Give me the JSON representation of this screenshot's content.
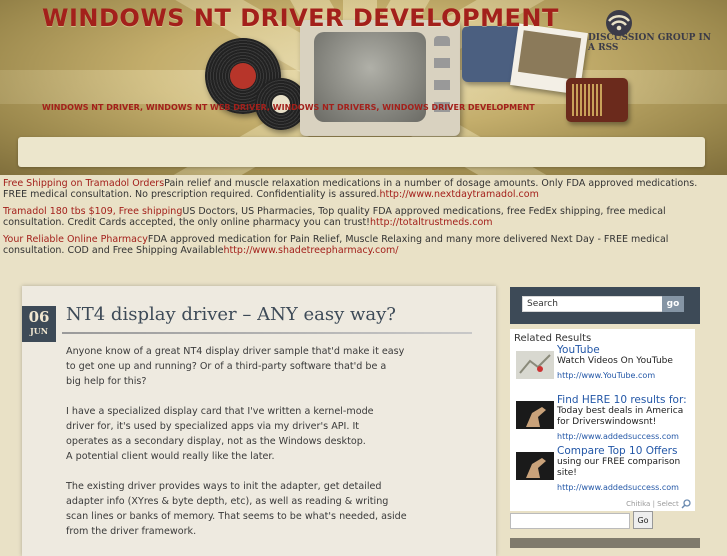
{
  "header": {
    "title": "WINDOWS NT DRIVER DEVELOPMENT",
    "description": "WINDOWS NT DRIVER, WINDOWS NT WEB DRIVER, WINDOWS NT DRIVERS, WINDOWS DRIVER DEVELOPMENT",
    "rss_label": "DISCUSSION GROUP IN A RSS"
  },
  "ads": [
    {
      "link": "Free Shipping on Tramadol Orders",
      "text": "Pain relief and muscle relaxation medications in a number of dosage amounts. Only FDA approved medications. FREE medical consultation. No prescription required. Confidentiality is assured.",
      "url": "http://www.nextdaytramadol.com"
    },
    {
      "link": "Tramadol 180 tbs $109, Free shipping",
      "text": "US Doctors, US Pharmacies, Top quality FDA approved medications, free FedEx shipping, free medical consultation. Credit Cards accepted, the only online pharmacy you can trust!",
      "url": "http://totaltrustmeds.com"
    },
    {
      "link": "Your Reliable Online Pharmacy",
      "text": "FDA approved medication for Pain Relief, Muscle Relaxing and many more delivered Next Day - FREE medical consultation. COD and Free Shipping Available",
      "url": "http://www.shadetreepharmacy.com/"
    }
  ],
  "post": {
    "day": "06",
    "month": "JUN",
    "title": "NT4 display driver – ANY easy way?",
    "paragraphs": [
      [
        "Anyone know of a great NT4 display driver sample that'd make it easy",
        "to get one up and running?  Or of a third-party software that'd be a",
        "big help for this?"
      ],
      [
        "I have a specialized display card that I've written a kernel-mode",
        "driver for, it's used by specialized apps via my driver's API.  It",
        "operates as a secondary display, not as the Windows desktop.",
        "A potential client would really like the later."
      ],
      [
        "The existing driver provides ways to init the adapter, get detailed",
        "adapter info (XYres & byte depth, etc), as well as reading & writing",
        "scan lines or banks of memory.  That seems to be what's needed, aside",
        "from the driver framework."
      ]
    ]
  },
  "sidebar": {
    "search_placeholder": "Search",
    "search_button": "go",
    "related_title": "Related Results",
    "related": [
      {
        "head": "YouTube",
        "desc": "Watch Videos On YouTube",
        "url": "http://www.YouTube.com"
      },
      {
        "head": "Find HERE 10 results for:",
        "desc": "Today best deals in America for Driverswindowsnt!",
        "url": "http://www.addedsuccess.com"
      },
      {
        "head": "Compare Top 10 Offers",
        "desc": "using our FREE comparison site!",
        "url": "http://www.addedsuccess.com"
      }
    ],
    "chitika": "Chitika | Select",
    "search2_button": "Go"
  }
}
